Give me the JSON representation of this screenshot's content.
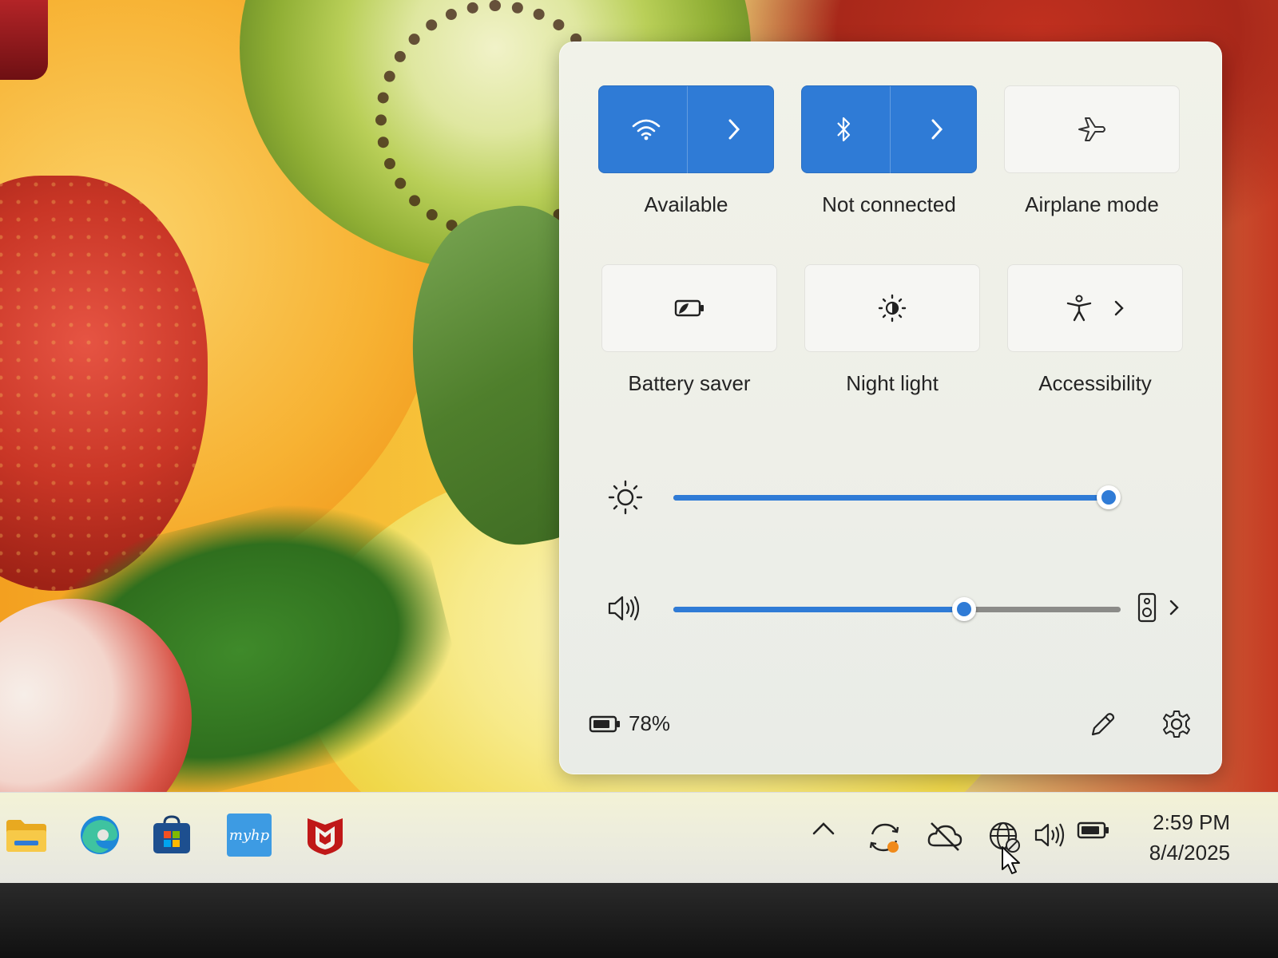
{
  "quick_settings": {
    "tiles": [
      {
        "label": "Available",
        "icon": "wifi-icon",
        "active": true,
        "has_arrow": true
      },
      {
        "label": "Not connected",
        "icon": "bluetooth-icon",
        "active": true,
        "has_arrow": true
      },
      {
        "label": "Airplane mode",
        "icon": "airplane-icon",
        "active": false,
        "has_arrow": false
      },
      {
        "label": "Battery saver",
        "icon": "battery-saver-icon",
        "active": false,
        "has_arrow": false
      },
      {
        "label": "Night light",
        "icon": "night-light-icon",
        "active": false,
        "has_arrow": false
      },
      {
        "label": "Accessibility",
        "icon": "accessibility-icon",
        "active": false,
        "has_arrow": true
      }
    ],
    "brightness": {
      "icon": "brightness-icon",
      "level": 1.0
    },
    "volume": {
      "icon": "volume-icon",
      "level": 0.65,
      "output_icon": "speaker-device-icon"
    },
    "battery": {
      "icon": "battery-icon",
      "percent": "78%"
    },
    "footer": {
      "edit_icon": "pencil-icon",
      "settings_icon": "gear-icon"
    }
  },
  "taskbar": {
    "apps": [
      {
        "name": "file-explorer",
        "icon": "folder-icon"
      },
      {
        "name": "edge",
        "icon": "edge-icon"
      },
      {
        "name": "microsoft-store",
        "icon": "store-icon"
      },
      {
        "name": "myhp",
        "icon": "myhp-icon",
        "text": "myhp"
      },
      {
        "name": "mcafee",
        "icon": "mcafee-icon"
      }
    ],
    "tray": [
      "chevron-up-icon",
      "sync-icon",
      "cloud-off-icon",
      "globe-no-internet-icon",
      "volume-icon",
      "battery-icon"
    ],
    "clock": {
      "time": "2:59 PM",
      "date": "8/4/2025"
    }
  },
  "colors": {
    "accent": "#2f7bd6",
    "panel": "#f0f1ea",
    "text": "#242424"
  }
}
